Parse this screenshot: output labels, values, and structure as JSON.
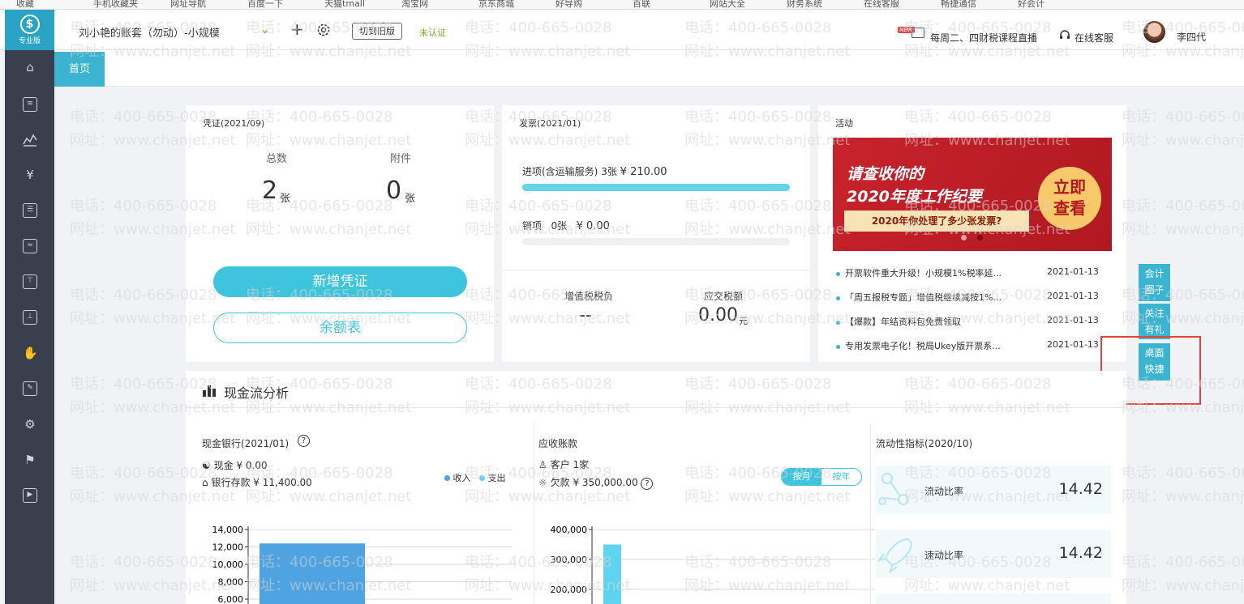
{
  "browser": {
    "bookmarks": [
      "收藏",
      "手机收藏夹",
      "网址导航",
      "百度一下",
      "天猫tmall",
      "淘宝网",
      "京东商城",
      "好导购",
      "百联",
      "网站大全",
      "财务系统",
      "在线客服",
      "畅捷通信",
      "好会计"
    ]
  },
  "header": {
    "logo_label": "专业版",
    "account_name": "刘小艳的账套（勿动）-小规模",
    "switch_old_label": "切到旧版",
    "unverified_label": "未认证",
    "new_badge": "NEW",
    "live_label": "每周二、四财税课程直播",
    "service_label": "在线客服",
    "username": "李四代"
  },
  "tabs": [
    {
      "label": "首页"
    }
  ],
  "sidebar": {
    "icons": [
      "home-icon",
      "voucher-icon",
      "chart-icon",
      "money-bag-icon",
      "ledger-icon",
      "report-icon",
      "tax-icon",
      "invoice-icon",
      "salary-icon",
      "asset-icon",
      "settings-icon",
      "promo-icon",
      "video-icon"
    ]
  },
  "voucher": {
    "title": "凭证(2021/09)",
    "total_label": "总数",
    "attach_label": "附件",
    "total_value": "2",
    "attach_value": "0",
    "unit": "张",
    "new_button": "新增凭证",
    "balance_button": "余额表"
  },
  "invoice": {
    "title": "发票(2021/01)",
    "in_label": "进项(含运输服务)",
    "in_count": "3张",
    "in_amount": "¥ 210.00",
    "in_fill": 1.0,
    "out_label": "销项",
    "out_count": "0张",
    "out_amount": "¥ 0.00",
    "out_fill": 0.0,
    "vat_label": "增值税税负",
    "vat_value": "--",
    "tax_label": "应交税额",
    "tax_value": "0.00",
    "tax_unit": "元"
  },
  "activity": {
    "title": "活动",
    "banner_line1": "请查收你的",
    "banner_line2": "2020年度工作纪要",
    "banner_line3": "2020年你处理了多少张发票?",
    "banner_cta_1": "立即",
    "banner_cta_2": "查看",
    "news": [
      {
        "text": "开票软件重大升级！小规模1%税率延...",
        "date": "2021-01-13"
      },
      {
        "text": "「周五报税专题」增值税继续减按1%...",
        "date": "2021-01-13"
      },
      {
        "text": "【爆款】年结资料包免费领取",
        "date": "2021-01-13"
      },
      {
        "text": "专用发票电子化！税局Ukey版开票系...",
        "date": "2021-01-13"
      }
    ]
  },
  "float_menu": {
    "item1_line1": "会计",
    "item1_line2": "圈子",
    "item2_line1": "关注",
    "item2_line2": "有礼",
    "item3_line1": "桌面",
    "item3_line2": "快捷"
  },
  "cashflow": {
    "title": "现金流分析",
    "bank_title": "现金银行(2021/01)",
    "cash_label": "现金",
    "cash_value": "¥ 0.00",
    "deposit_label": "银行存款",
    "deposit_value": "¥ 11,400.00",
    "legend_income": "收入",
    "legend_expense": "支出",
    "ar_title": "应收账款",
    "customer_label": "客户",
    "customer_value": "1家",
    "owed_label": "欠款",
    "owed_value": "¥ 350,000.00",
    "toggle_month": "按月",
    "toggle_year": "按年",
    "liquidity_title": "流动性指标(2020/10)",
    "current_ratio_label": "流动比率",
    "current_ratio_value": "14.42",
    "quick_ratio_label": "速动比率",
    "quick_ratio_value": "14.42"
  },
  "watermark": {
    "phone": "电话：400-665-0028",
    "site": "网址：www.chanjet.net"
  },
  "colors": {
    "accent": "#3ec4dc",
    "sidebar": "#3a3f4e",
    "income_bar": "#4ea3e0",
    "expense_bar": "#5fd3f0",
    "highlight": "#e2433b"
  },
  "chart_data": [
    {
      "type": "bar",
      "categories": [
        ""
      ],
      "series": [
        {
          "name": "收入",
          "values": [
            12400
          ]
        }
      ],
      "yticks": [
        "14,000",
        "12,000",
        "10,000",
        "8,000",
        "6,000"
      ],
      "ylim": [
        6000,
        14000
      ]
    },
    {
      "type": "bar",
      "categories": [
        ""
      ],
      "series": [
        {
          "values": [
            350000
          ]
        }
      ],
      "yticks": [
        "400,000",
        "300,000",
        "200,000"
      ],
      "ylim": [
        200000,
        400000
      ]
    }
  ]
}
